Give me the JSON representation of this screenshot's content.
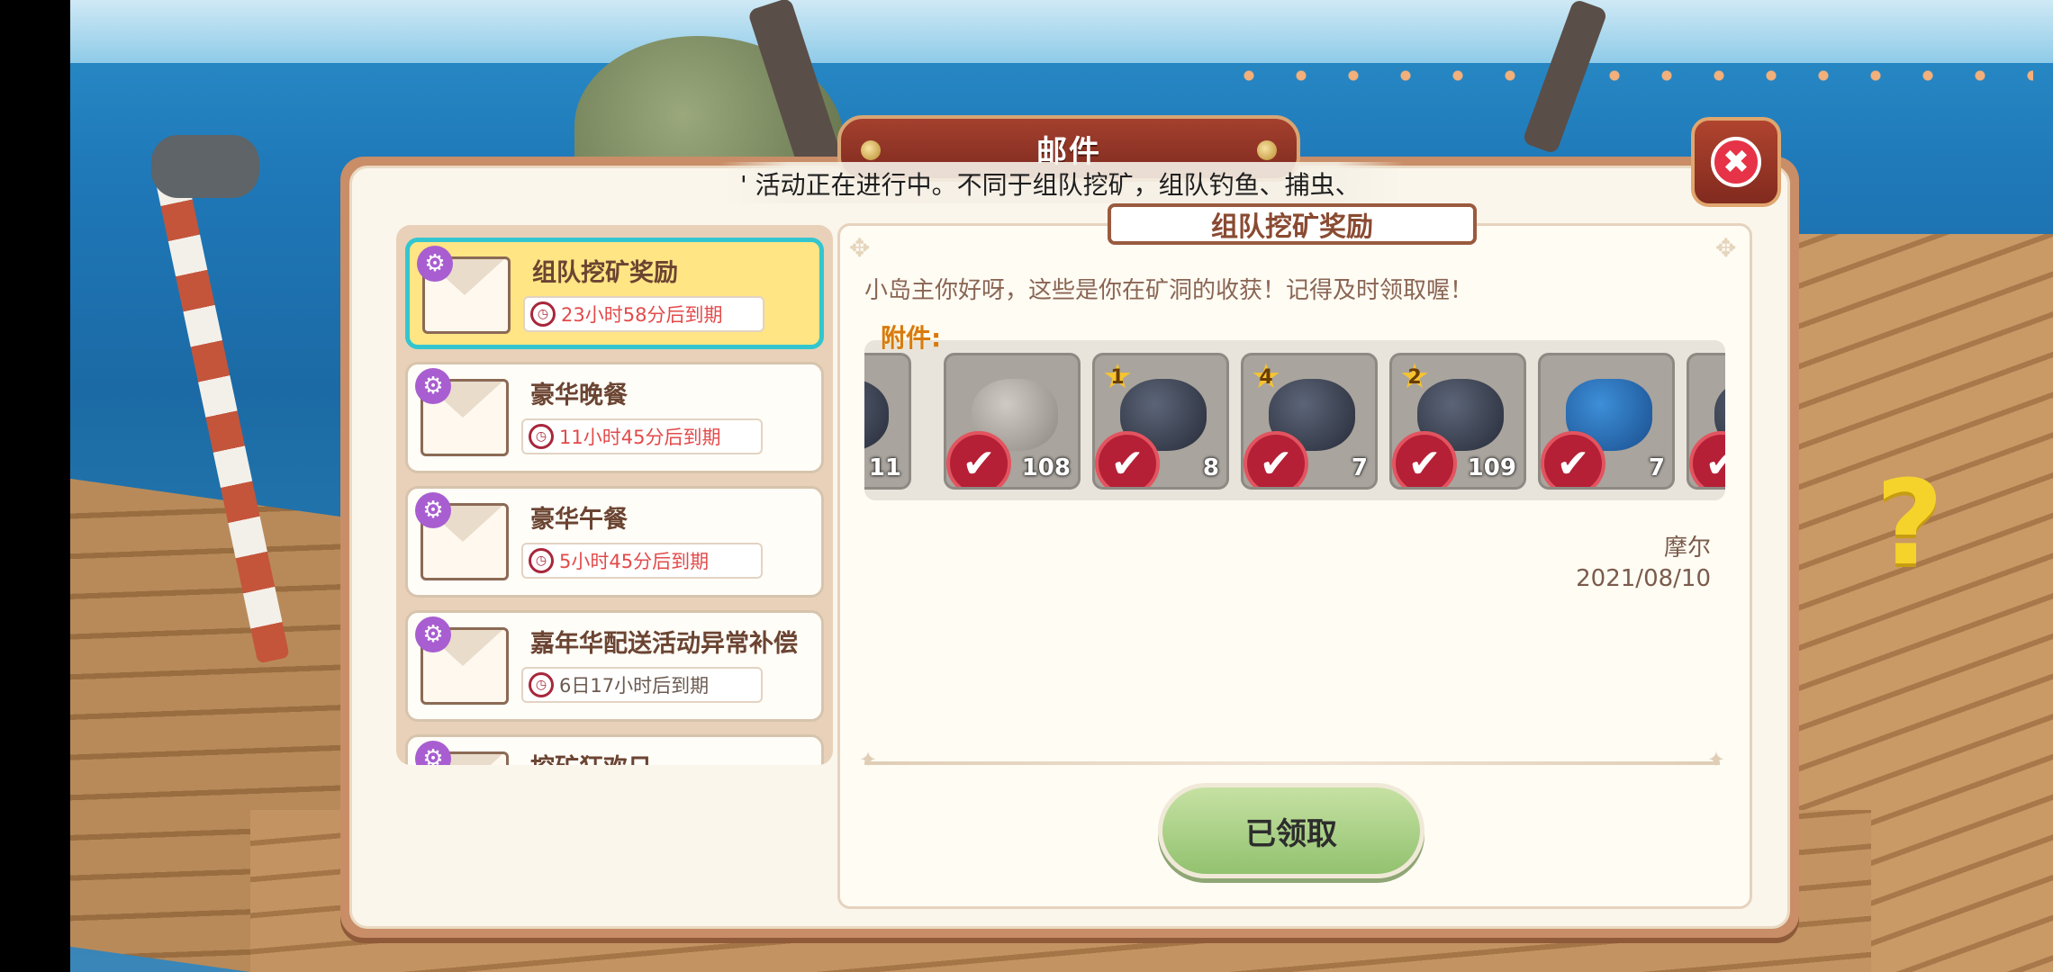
{
  "dialog": {
    "title": "邮件",
    "ticker": "' 活动正在进行中。不同于组队挖矿，组队钓鱼、捕虫、",
    "close_icon": "✖"
  },
  "mail_list": [
    {
      "title": "组队挖矿奖励",
      "expiry": "23小时58分后到期",
      "selected": true
    },
    {
      "title": "豪华晚餐",
      "expiry": "11小时45分后到期",
      "selected": false
    },
    {
      "title": "豪华午餐",
      "expiry": "5小时45分后到期",
      "selected": false
    },
    {
      "title": "嘉年华配送活动异常补偿",
      "expiry": "6日17小时后到期",
      "selected": false
    },
    {
      "title": "挖矿狂欢日",
      "expiry": "",
      "selected": false
    }
  ],
  "detail": {
    "title": "组队挖矿奖励",
    "greeting": "小岛主你好呀，这些是你在矿洞的收获！记得及时领取喔！",
    "attachments_label": "附件:",
    "attachments": [
      {
        "icon": "ore",
        "qty": "11",
        "stars": ""
      },
      {
        "icon": "stone",
        "qty": "108",
        "stars": ""
      },
      {
        "icon": "ore",
        "qty": "8",
        "stars": "1"
      },
      {
        "icon": "ore",
        "qty": "7",
        "stars": "4"
      },
      {
        "icon": "ore",
        "qty": "109",
        "stars": "2"
      },
      {
        "icon": "sack",
        "qty": "7",
        "stars": ""
      },
      {
        "icon": "ore",
        "qty": "",
        "stars": ""
      }
    ],
    "sender": "摩尔",
    "date": "2021/08/10",
    "claim_button": "已领取"
  },
  "icons": {
    "gear": "⚙",
    "clock": "⏰",
    "check": "✔",
    "star": "★"
  },
  "colors": {
    "selected_border": "#33c6cf",
    "selected_bg": "#ffe584",
    "expiry_red": "#e34a4a",
    "claim_green": "#92c26f",
    "title_red": "#7e2a1f"
  }
}
